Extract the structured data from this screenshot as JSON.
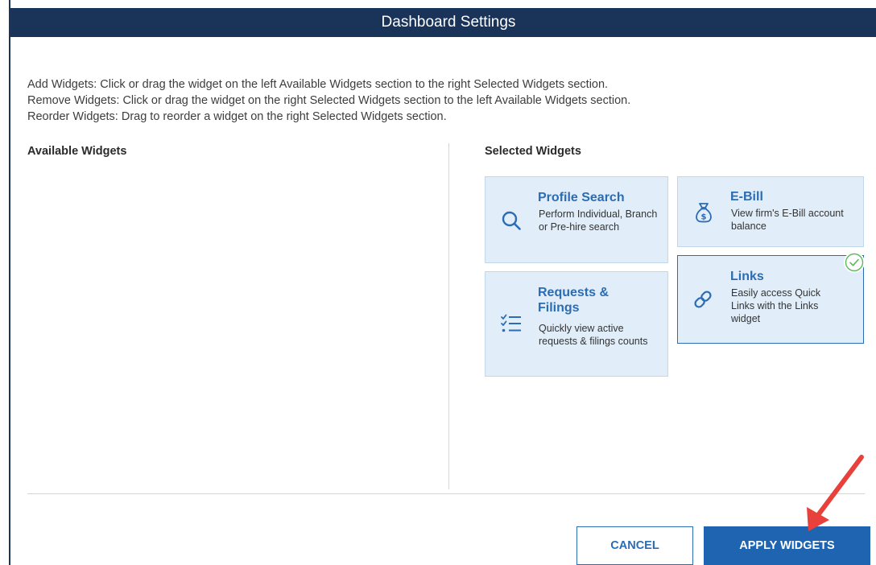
{
  "dialog": {
    "title": "Dashboard Settings"
  },
  "instructions": [
    "Add Widgets: Click or drag the widget on the left Available Widgets section to the right Selected Widgets section.",
    "Remove Widgets: Click or drag the widget on the right Selected Widgets section to the left Available Widgets section.",
    "Reorder Widgets: Drag to reorder a widget on the right Selected Widgets section."
  ],
  "available": {
    "title": "Available Widgets"
  },
  "selected": {
    "title": "Selected Widgets",
    "widgets": [
      {
        "title": "Profile Search",
        "description": "Perform Individual, Branch or Pre-hire search",
        "icon": "search-icon"
      },
      {
        "title": "E-Bill",
        "description": "View firm's E-Bill account balance",
        "icon": "money-bag-icon"
      },
      {
        "title": "Requests & Filings",
        "description": "Quickly view active requests & filings counts",
        "icon": "checklist-icon"
      },
      {
        "title": "Links",
        "description": "Easily access Quick Links with the Links widget",
        "icon": "link-icon",
        "selected": true
      }
    ]
  },
  "buttons": {
    "cancel": "CANCEL",
    "apply": "APPLY WIDGETS"
  },
  "colors": {
    "title_bar": "#1a3358",
    "accent": "#2b6cb3",
    "widget_bg": "#e1eef9",
    "primary_button": "#1f64b0",
    "arrow": "#e8403a",
    "check": "#5cb85c"
  }
}
